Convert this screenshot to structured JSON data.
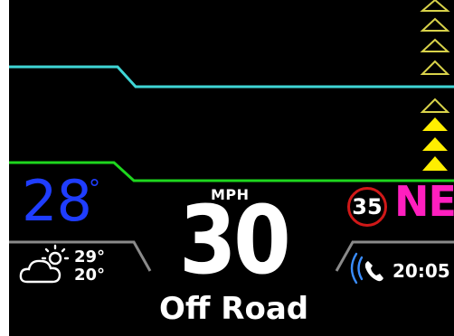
{
  "colors": {
    "background": "#000000",
    "lane_line_upper": "#3fd6d6",
    "lane_line_lower": "#1ed61e",
    "divider": "#8a8a8a",
    "temperature": "#1f3dff",
    "heading": "#ff1fbf",
    "speed_limit_ring": "#d01818",
    "arrow_outline": "#d8d24a",
    "arrow_fill": "#ffee00"
  },
  "weather": {
    "current_temp": "28",
    "degree_symbol": "°",
    "condition_icon": "partly-cloudy-icon",
    "forecast_high": "29°",
    "forecast_low": "20°"
  },
  "speed": {
    "unit": "MPH",
    "value": "30",
    "limit": "35"
  },
  "drive_mode": "Off Road",
  "compass": {
    "heading": "NE"
  },
  "phone": {
    "icon": "phone-call-icon",
    "time": "20:05"
  },
  "nav_arrows": {
    "upper_group": {
      "icon": "triangle-outline-icon",
      "count": 4
    },
    "lower_group": {
      "icon": "triangle-filled-icon",
      "count": 4
    }
  }
}
